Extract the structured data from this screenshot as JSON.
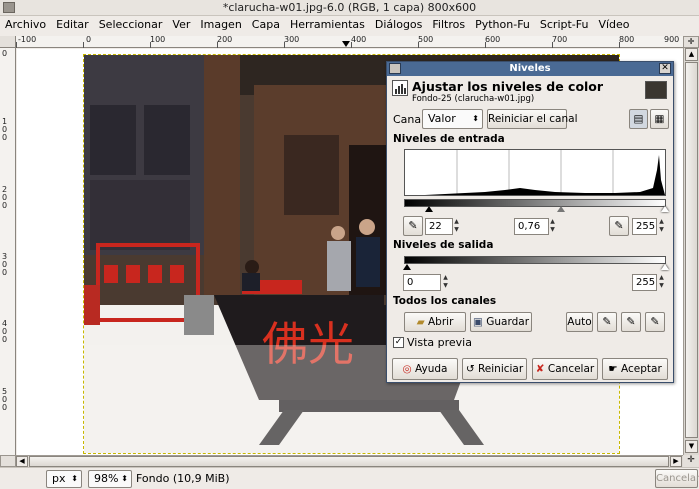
{
  "window": {
    "title": "*clarucha-w01.jpg-6.0 (RGB, 1 capa) 800x600"
  },
  "menu": [
    "Archivo",
    "Editar",
    "Seleccionar",
    "Ver",
    "Imagen",
    "Capa",
    "Herramientas",
    "Diálogos",
    "Filtros",
    "Python-Fu",
    "Script-Fu",
    "Vídeo"
  ],
  "ruler": {
    "h_labels": [
      "-100",
      "0",
      "100",
      "200",
      "300",
      "400",
      "500",
      "600",
      "700",
      "800",
      "900"
    ],
    "v_labels": [
      "0",
      "100",
      "200",
      "300",
      "400",
      "500"
    ]
  },
  "photo": {
    "sign_text": "佛光"
  },
  "status": {
    "unit": "px",
    "zoom": "98%",
    "layer_info": "Fondo (10,9 MiB)",
    "cancel_label": "Cancelar"
  },
  "dialog": {
    "title": "Niveles",
    "heading": "Ajustar los niveles de color",
    "subheading": "Fondo-25 (clarucha-w01.jpg)",
    "channel_label": "Canal:",
    "channel_value": "Valor",
    "reset_channel": "Reiniciar el canal",
    "input_levels_label": "Niveles de entrada",
    "input_low": "22",
    "input_gamma": "0,76",
    "input_high": "255",
    "output_levels_label": "Niveles de salida",
    "output_low": "0",
    "output_high": "255",
    "all_channels_label": "Todos los canales",
    "open_label": "Abrir",
    "save_label": "Guardar",
    "auto_label": "Auto",
    "preview_label": "Vista previa",
    "preview_checked": true,
    "help_label": "Ayuda",
    "reset_label": "Reiniciar",
    "cancel_label": "Cancelar",
    "ok_label": "Aceptar"
  }
}
